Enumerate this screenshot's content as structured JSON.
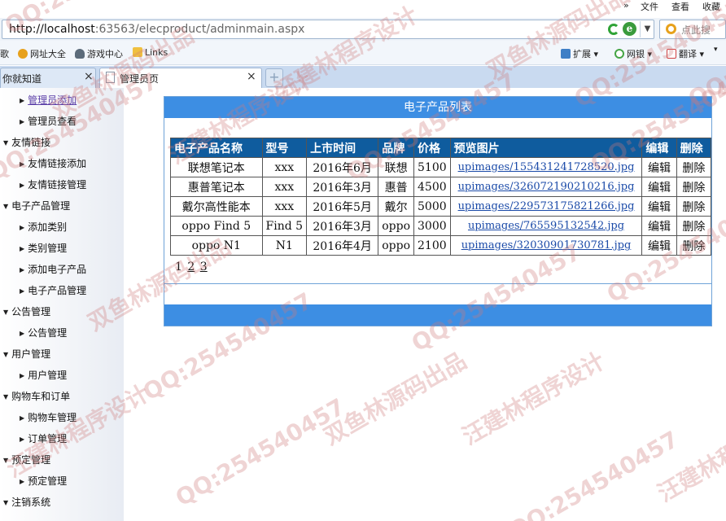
{
  "browser": {
    "menu": {
      "arrows": "»",
      "file": "文件",
      "view": "查看",
      "favorites": "收藏"
    },
    "url_host": "http://localhost",
    "url_rest": ":63563/elecproduct/adminmain.aspx",
    "search_placeholder": "点此搜",
    "favbar": {
      "cut_item": "歌",
      "sites": "网址大全",
      "games": "游戏中心",
      "links": "Links",
      "extensions": "扩展",
      "bank": "网银",
      "translate": "翻译",
      "dropdown": "▾"
    },
    "tabs": [
      {
        "title": "你就知道",
        "close": "×"
      },
      {
        "title": "管理员页",
        "close": "×"
      }
    ],
    "new_tab": "+"
  },
  "sidebar": {
    "nodes": [
      {
        "label": "管理员添加",
        "level": "child",
        "current": true
      },
      {
        "label": "管理员查看",
        "level": "child"
      },
      {
        "label": "友情链接",
        "level": "group"
      },
      {
        "label": "友情链接添加",
        "level": "child"
      },
      {
        "label": "友情链接管理",
        "level": "child"
      },
      {
        "label": "电子产品管理",
        "level": "group"
      },
      {
        "label": "添加类别",
        "level": "child"
      },
      {
        "label": "类别管理",
        "level": "child"
      },
      {
        "label": "添加电子产品",
        "level": "child"
      },
      {
        "label": "电子产品管理",
        "level": "child"
      },
      {
        "label": "公告管理",
        "level": "group"
      },
      {
        "label": "公告管理",
        "level": "child"
      },
      {
        "label": "用户管理",
        "level": "group"
      },
      {
        "label": "用户管理",
        "level": "child"
      },
      {
        "label": "购物车和订单",
        "level": "group"
      },
      {
        "label": "购物车管理",
        "level": "child"
      },
      {
        "label": "订单管理",
        "level": "child"
      },
      {
        "label": "预定管理",
        "level": "group"
      },
      {
        "label": "预定管理",
        "level": "child"
      },
      {
        "label": "注销系统",
        "level": "group"
      }
    ]
  },
  "panel": {
    "title": "电子产品列表",
    "columns": [
      "电子产品名称",
      "型号",
      "上市时间",
      "品牌",
      "价格",
      "预览图片",
      "编辑",
      "删除"
    ],
    "rows": [
      {
        "name": "联想笔记本",
        "model": "xxx",
        "date": "2016年6月",
        "brand": "联想",
        "price": "5100",
        "image": "upimages/155431241728520.jpg",
        "edit": "编辑",
        "delete": "删除"
      },
      {
        "name": "惠普笔记本",
        "model": "xxx",
        "date": "2016年3月",
        "brand": "惠普",
        "price": "4500",
        "image": "upimages/326072190210216.jpg",
        "edit": "编辑",
        "delete": "删除"
      },
      {
        "name": "戴尔高性能本",
        "model": "xxx",
        "date": "2016年5月",
        "brand": "戴尔",
        "price": "5000",
        "image": "upimages/229573175821266.jpg",
        "edit": "编辑",
        "delete": "删除"
      },
      {
        "name": "oppo Find 5",
        "model": "Find 5",
        "date": "2016年3月",
        "brand": "oppo",
        "price": "3000",
        "image": "upimages/765595132542.jpg",
        "edit": "编辑",
        "delete": "删除"
      },
      {
        "name": "oppo N1",
        "model": "N1",
        "date": "2016年4月",
        "brand": "oppo",
        "price": "2100",
        "image": "upimages/32030901730781.jpg",
        "edit": "编辑",
        "delete": "删除"
      }
    ],
    "pager": {
      "current": "1",
      "pages": [
        "2",
        "3"
      ]
    }
  },
  "watermarks": [
    "双鱼林源码出品",
    "汪建林程序设计",
    "QQ:254540457"
  ],
  "colors": {
    "header_blue": "#3d8ee3",
    "table_header": "#0f5c9e",
    "link": "#1a4aa8",
    "watermark": "#cd7878"
  }
}
